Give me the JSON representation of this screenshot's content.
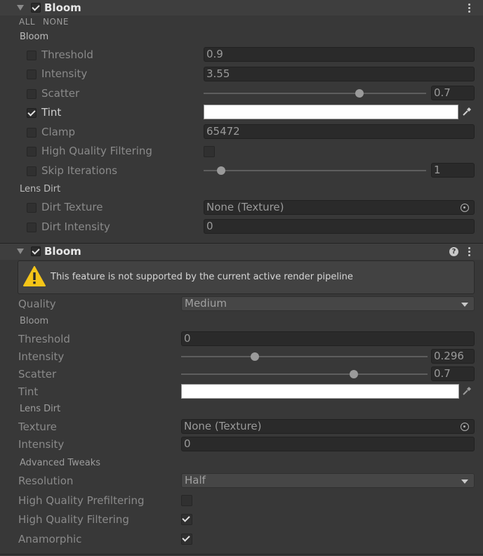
{
  "panel1": {
    "title": "Bloom",
    "all_label": "ALL",
    "none_label": "NONE",
    "section_bloom": "Bloom",
    "section_lens_dirt": "Lens Dirt",
    "threshold": {
      "label": "Threshold",
      "value": "0.9"
    },
    "intensity": {
      "label": "Intensity",
      "value": "3.55"
    },
    "scatter": {
      "label": "Scatter",
      "value": "0.7",
      "fraction": 0.7
    },
    "tint": {
      "label": "Tint",
      "color": "#ffffff"
    },
    "clamp": {
      "label": "Clamp",
      "value": "65472"
    },
    "hq_filtering": {
      "label": "High Quality Filtering"
    },
    "skip_iterations": {
      "label": "Skip Iterations",
      "value": "1",
      "fraction": 0.08
    },
    "dirt_texture": {
      "label": "Dirt Texture",
      "value": "None (Texture)"
    },
    "dirt_intensity": {
      "label": "Dirt Intensity",
      "value": "0"
    }
  },
  "panel2": {
    "title": "Bloom",
    "warning": "This feature is not supported by the current active render pipeline",
    "quality": {
      "label": "Quality",
      "value": "Medium"
    },
    "section_bloom": "Bloom",
    "threshold": {
      "label": "Threshold",
      "value": "0"
    },
    "intensity": {
      "label": "Intensity",
      "value": "0.296",
      "fraction": 0.3
    },
    "scatter": {
      "label": "Scatter",
      "value": "0.7",
      "fraction": 0.7
    },
    "tint": {
      "label": "Tint",
      "color": "#ffffff"
    },
    "section_lens_dirt": "Lens Dirt",
    "texture": {
      "label": "Texture",
      "value": "None (Texture)"
    },
    "dirt_intensity": {
      "label": "Intensity",
      "value": "0"
    },
    "section_advanced": "Advanced Tweaks",
    "resolution": {
      "label": "Resolution",
      "value": "Half"
    },
    "hq_prefiltering": {
      "label": "High Quality Prefiltering",
      "checked": false
    },
    "hq_filtering": {
      "label": "High Quality Filtering",
      "checked": true
    },
    "anamorphic": {
      "label": "Anamorphic",
      "checked": true
    }
  }
}
